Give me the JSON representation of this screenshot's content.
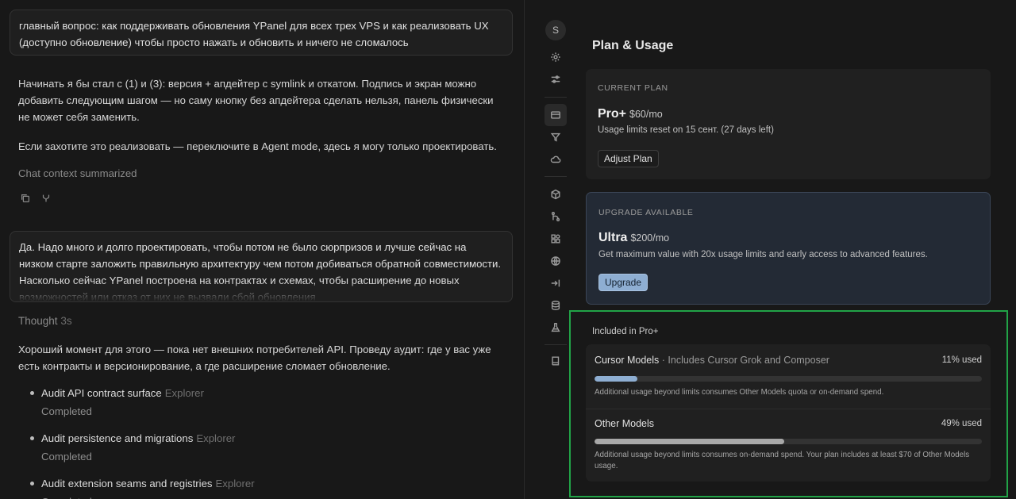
{
  "chat": {
    "user_message_1": "главный вопрос: как поддерживать обновления YPanel для всех трех VPS и как реализовать UX (доступно обновление) чтобы просто нажать и обновить и ничего не сломалось",
    "reply_para_1": "Начинать я бы стал с (1) и (3): версия + апдейтер с symlink и откатом. Подпись и экран можно добавить следующим шагом — но саму кнопку без апдейтера сделать нельзя, панель физически не может себя заменить.",
    "reply_para_2": "Если захотите это реализовать — переключите в Agent mode, здесь я могу только проектировать.",
    "context_note": "Chat context summarized",
    "user_message_2": "Да. Надо много и долго проектировать, чтобы потом не было сюрпризов и лучше сейчас на низком старте заложить правильную архитектуру чем потом добиваться обратной совместимости. Насколько сейчас YPanel построена на контрактах и схемах, чтобы расширение до новых возможностей или отказ от них не вызвали сбой обновления",
    "thought_label": "Thought",
    "thought_duration": "3s",
    "reply_para_3": "Хороший момент для этого — пока нет внешних потребителей API. Проведу аудит: где у вас уже есть контракты и версионирование, а где расширение сломает обновление.",
    "tasks": [
      {
        "title": "Audit API contract surface",
        "agent": "Explorer",
        "status": "Completed"
      },
      {
        "title": "Audit persistence and migrations",
        "agent": "Explorer",
        "status": "Completed"
      },
      {
        "title": "Audit extension seams and registries",
        "agent": "Explorer",
        "status": "Completed"
      }
    ]
  },
  "rail": {
    "avatar_letter": "S",
    "icons": [
      "gear-icon",
      "sliders-icon",
      "billing-icon",
      "filter-icon",
      "cloud-icon",
      "cube-icon",
      "git-icon",
      "apps-icon",
      "globe-icon",
      "arrow-to-line-icon",
      "database-icon",
      "beaker-icon",
      "book-icon"
    ]
  },
  "plan": {
    "title": "Plan & Usage",
    "current": {
      "label": "CURRENT PLAN",
      "name": "Pro+",
      "price": "$60/mo",
      "reset": "Usage limits reset on 15 сент. (27 days left)",
      "button": "Adjust Plan"
    },
    "upgrade": {
      "label": "UPGRADE AVAILABLE",
      "name": "Ultra",
      "price": "$200/mo",
      "desc": "Get maximum value with 20x usage limits and early access to advanced features.",
      "button": "Upgrade"
    },
    "included_label": "Included in Pro+",
    "usage": [
      {
        "name": "Cursor Models",
        "sub": " · Includes Cursor Grok and Composer",
        "pct_label": "11% used",
        "pct": 11,
        "color": "#8eaed2",
        "note": "Additional usage beyond limits consumes Other Models quota or on-demand spend."
      },
      {
        "name": "Other Models",
        "sub": "",
        "pct_label": "49% used",
        "pct": 49,
        "color": "#a8a8a8",
        "note": "Additional usage beyond limits consumes on-demand spend. Your plan includes at least $70 of Other Models usage."
      }
    ]
  }
}
